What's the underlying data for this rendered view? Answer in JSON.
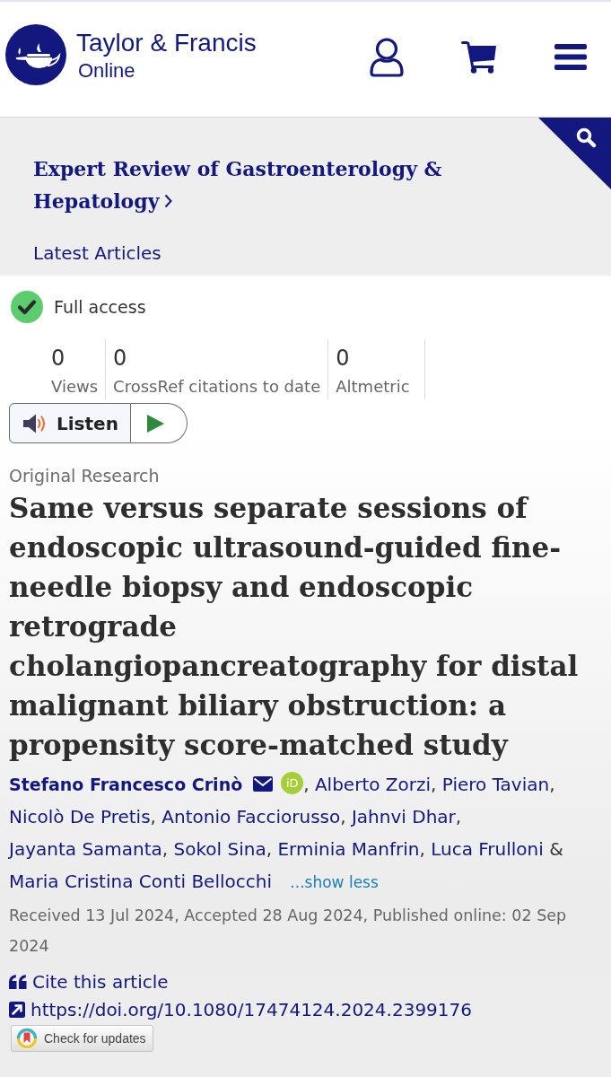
{
  "header": {
    "brand_name": "Taylor & Francis",
    "brand_subtitle": "Online"
  },
  "journal": {
    "title": "Expert Review of Gastroenterology & Hepatology",
    "section": "Latest Articles"
  },
  "access": {
    "label": "Full access"
  },
  "metrics": [
    {
      "value": "0",
      "label": "Views"
    },
    {
      "value": "0",
      "label": "CrossRef citations to date"
    },
    {
      "value": "0",
      "label": "Altmetric"
    }
  ],
  "listen": {
    "label": "Listen"
  },
  "article": {
    "type": "Original Research",
    "title": "Same versus separate sessions of endoscopic ultrasound-guided fine-needle biopsy and endoscopic retrograde cholangiopancreatography for distal malignant biliary obstruction: a propensity score-matched study",
    "authors": [
      {
        "name": "Stefano Francesco Crinò",
        "corresponding": true,
        "orcid": "iD",
        "separator": ","
      },
      {
        "name": "Alberto Zorzi",
        "corresponding": false,
        "separator": ","
      },
      {
        "name": "Piero Tavian",
        "corresponding": false,
        "separator": ","
      },
      {
        "name": "Nicolò De Pretis",
        "corresponding": false,
        "separator": ","
      },
      {
        "name": "Antonio Facciorusso",
        "corresponding": false,
        "separator": ","
      },
      {
        "name": "Jahnvi Dhar",
        "corresponding": false,
        "separator": ","
      },
      {
        "name": "Jayanta Samanta",
        "corresponding": false,
        "separator": ","
      },
      {
        "name": "Sokol Sina",
        "corresponding": false,
        "separator": ","
      },
      {
        "name": "Erminia Manfrin",
        "corresponding": false,
        "separator": ","
      },
      {
        "name": "Luca Frulloni",
        "corresponding": false,
        "conjunction": "&"
      },
      {
        "name": "Maria Cristina Conti Bellocchi",
        "corresponding": false
      }
    ],
    "show_less": "...show less",
    "history": "Received 13 Jul 2024, Accepted 28 Aug 2024, Published online: 02 Sep 2024",
    "cite": "Cite this article",
    "doi": "https://doi.org/10.1080/17474124.2024.2399176",
    "check_updates": "Check for updates"
  }
}
